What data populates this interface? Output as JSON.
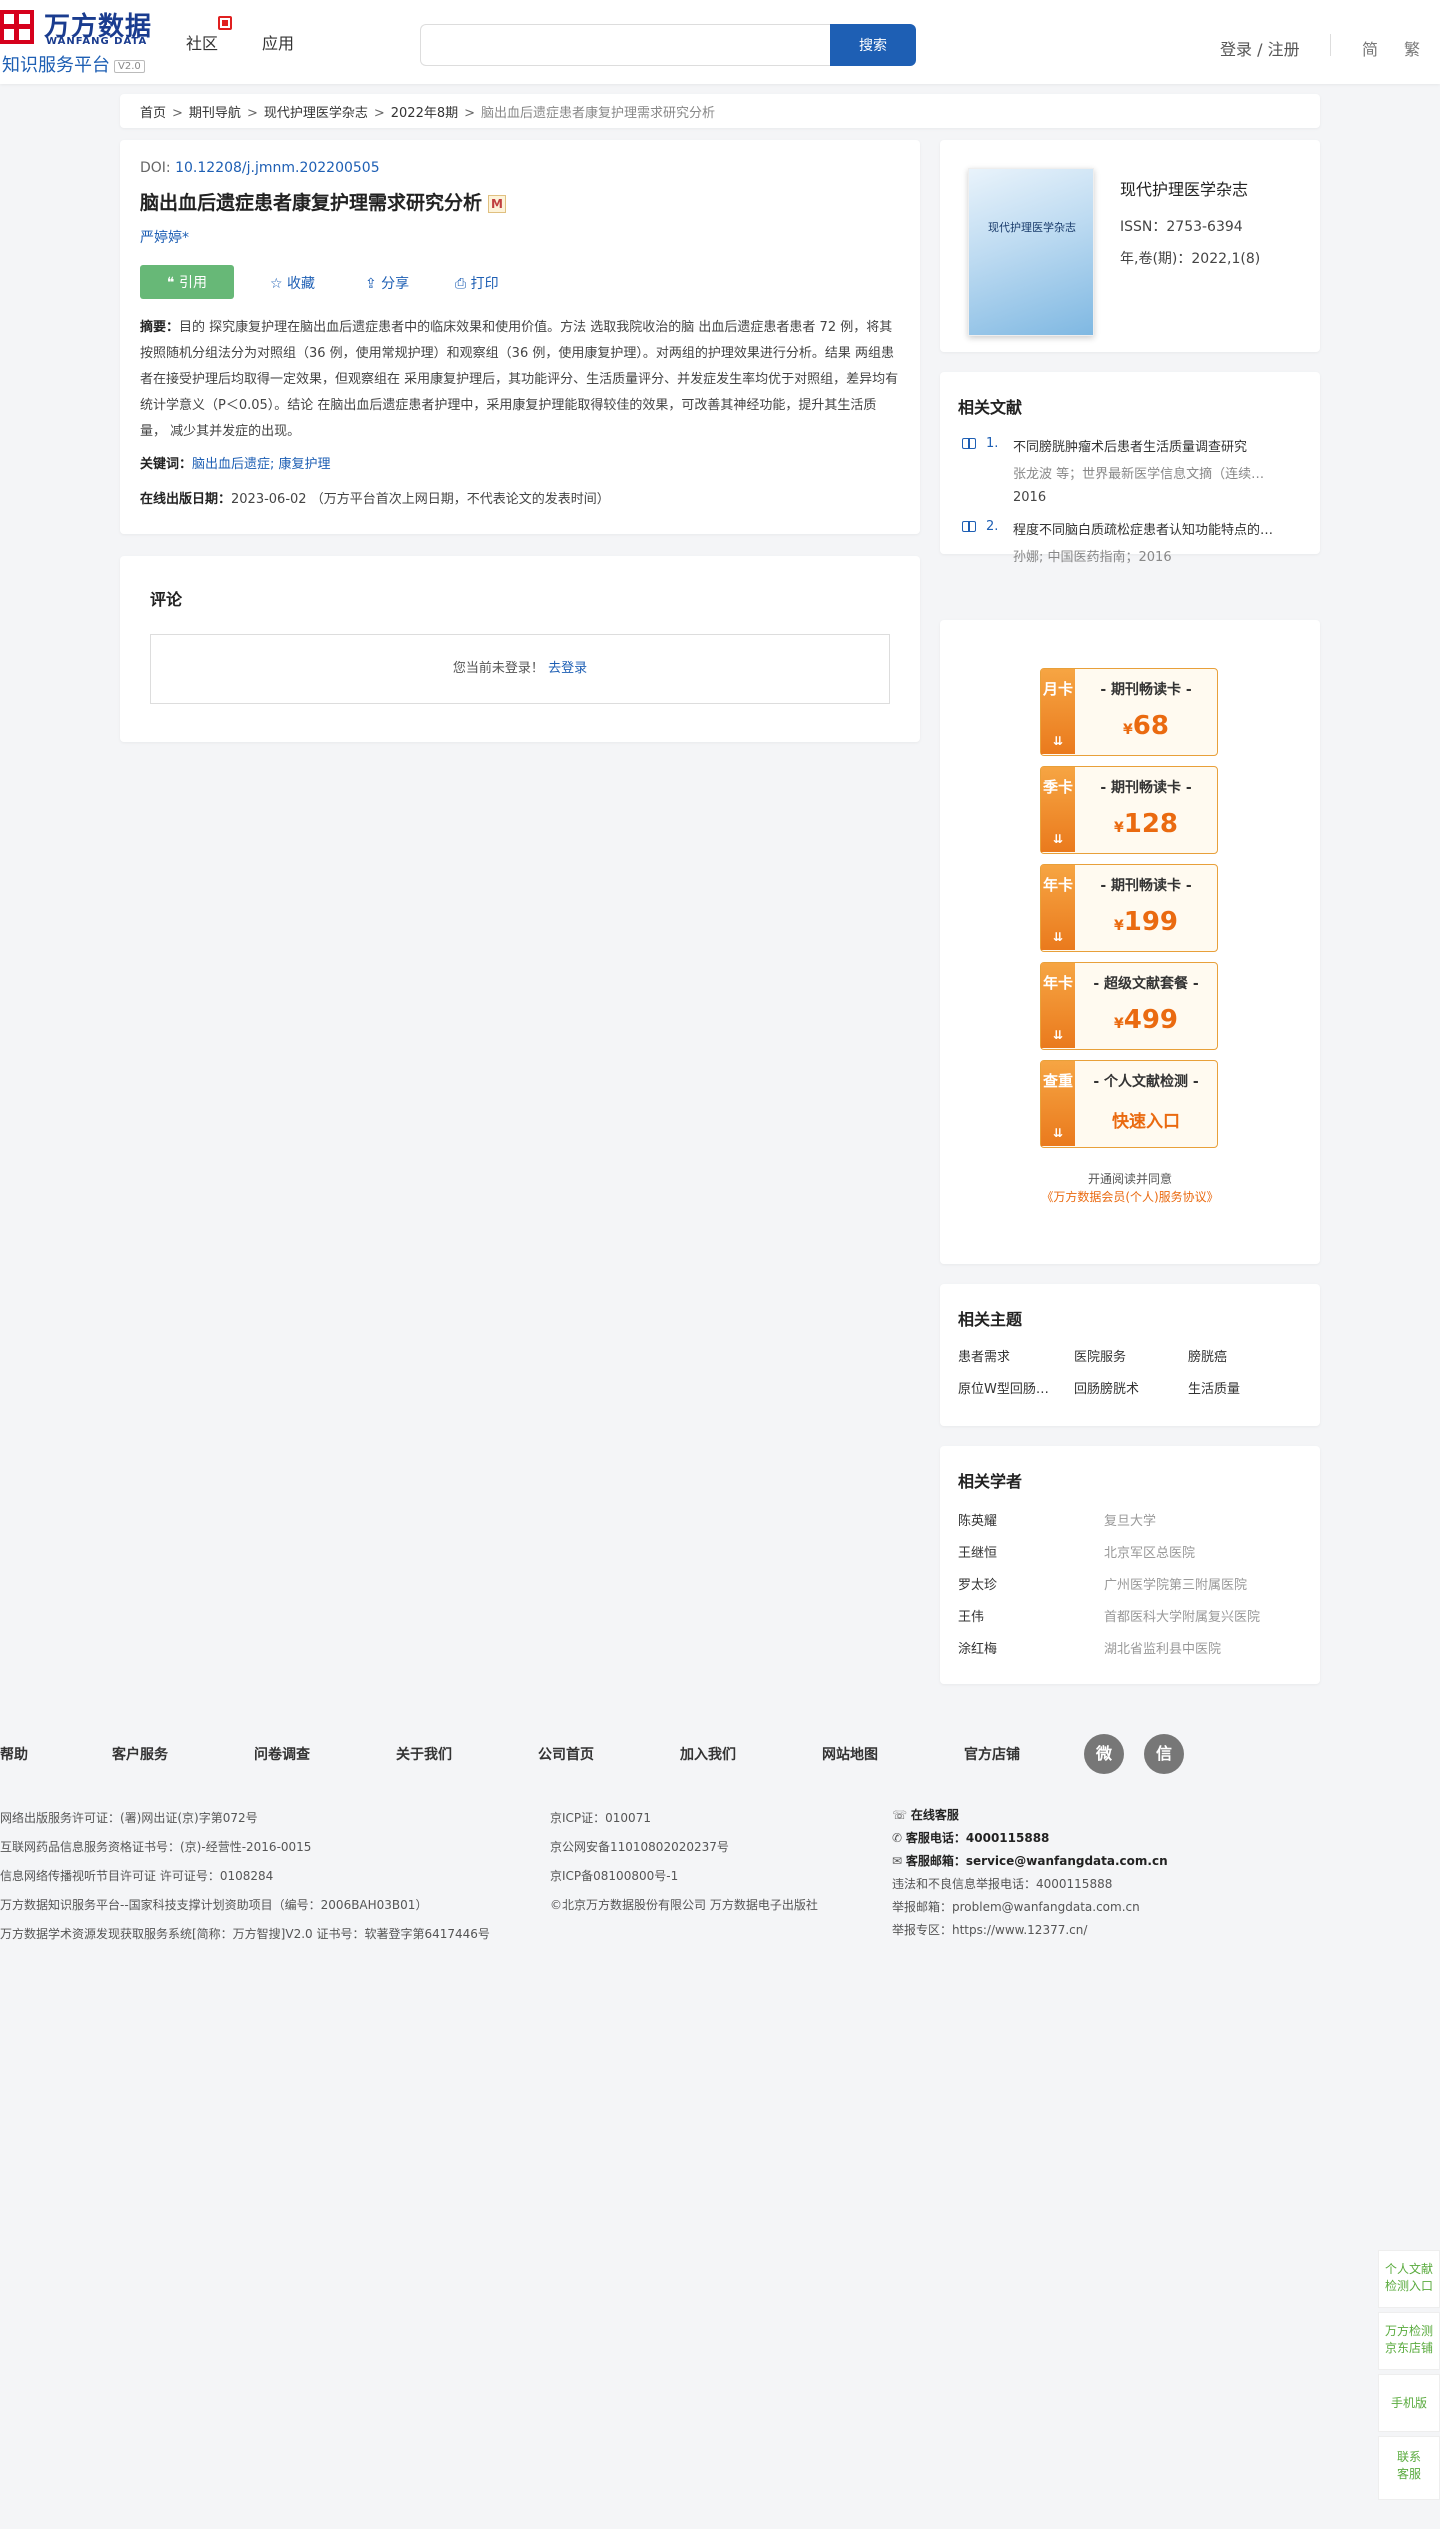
{
  "header": {
    "logo_cn": "万方数据",
    "logo_en": "WANFANG DATA",
    "logo_sub": "知识服务平台",
    "logo_ver": "V2.0",
    "nav": [
      "社区",
      "应用"
    ],
    "search_placeholder": "",
    "search_button": "搜索",
    "login": "登录 / 注册",
    "lang_simple": "简",
    "lang_trad": "繁"
  },
  "breadcrumb": {
    "items": [
      "首页",
      "期刊导航",
      "现代护理医学杂志",
      "2022年8期"
    ],
    "current": "脑出血后遗症患者康复护理需求研究分析",
    "sep": ">"
  },
  "article": {
    "doi_label": "DOI: ",
    "doi": "10.12208/j.jmnm.202200505",
    "title": "脑出血后遗症患者康复护理需求研究分析",
    "title_icon": "M",
    "author": "严婷婷*",
    "cite_label": "❝ 引用",
    "collect_label": "☆ 收藏",
    "share_label": "⇪ 分享",
    "print_label": "⎙ 打印",
    "abstract_label": "摘要：",
    "abstract": "目的 探究康复护理在脑出血后遗症患者中的临床效果和使用价值。方法 选取我院收治的脑 出血后遗症患者患者 72 例，将其按照随机分组法分为对照组（36 例，使用常规护理）和观察组（36 例，使用康复护理）。对两组的护理效果进行分析。结果 两组患者在接受护理后均取得一定效果，但观察组在 采用康复护理后，其功能评分、生活质量评分、并发症发生率均优于对照组，差异均有统计学意义（P＜0.05）。结论 在脑出血后遗症患者护理中，采用康复护理能取得较佳的效果，可改善其神经功能，提升其生活质量， 减少其并发症的出现。",
    "keywords_label": "关键词：",
    "keywords": [
      "脑出血后遗症;",
      "康复护理"
    ],
    "online_label": "在线出版日期：",
    "online_date": "2023-06-02 （万方平台首次上网日期，不代表论文的发表时间）"
  },
  "comments": {
    "title": "评论",
    "not_logged": "您当前未登录！",
    "go_login": "去登录"
  },
  "journal": {
    "cover_title": "现代护理医学杂志",
    "name": "现代护理医学杂志",
    "issn": "ISSN：2753-6394",
    "volume": "年,卷(期)：2022,1(8)"
  },
  "related_docs": {
    "title": "相关文献",
    "items": [
      {
        "num": "1.",
        "title": "不同膀胱肿瘤术后患者生活质量调查研究",
        "meta": "张龙波 等；世界最新医学信息文摘（连续…",
        "year": "2016"
      },
      {
        "num": "2.",
        "title": "程度不同脑白质疏松症患者认知功能特点的…",
        "meta": "孙娜; 中国医药指南；2016",
        "year": ""
      }
    ]
  },
  "vip_cards": [
    {
      "side": "月卡",
      "name": "- 期刊畅读卡 -",
      "currency": "¥",
      "price": "68"
    },
    {
      "side": "季卡",
      "name": "- 期刊畅读卡 -",
      "currency": "¥",
      "price": "128"
    },
    {
      "side": "年卡",
      "name": "- 期刊畅读卡 -",
      "currency": "¥",
      "price": "199"
    },
    {
      "side": "年卡",
      "name": "- 超级文献套餐 -",
      "currency": "¥",
      "price": "499"
    },
    {
      "side": "查重",
      "name": "- 个人文献检测 -",
      "link": "快速入口"
    }
  ],
  "vip_agree": {
    "line1": "开通阅读并同意",
    "line2": "《万方数据会员(个人)服务协议》"
  },
  "topics": {
    "title": "相关主题",
    "items": [
      "患者需求",
      "医院服务",
      "膀胱癌",
      "原位W型回肠…",
      "回肠膀胱术",
      "生活质量"
    ]
  },
  "scholars": {
    "title": "相关学者",
    "items": [
      {
        "name": "陈英耀",
        "org": "复旦大学"
      },
      {
        "name": "王继恒",
        "org": "北京军区总医院"
      },
      {
        "name": "罗太珍",
        "org": "广州医学院第三附属医院"
      },
      {
        "name": "王伟",
        "org": "首都医科大学附属复兴医院"
      },
      {
        "name": "涂红梅",
        "org": "湖北省监利县中医院"
      }
    ]
  },
  "footer": {
    "links": [
      "帮助",
      "客户服务",
      "问卷调查",
      "关于我们",
      "公司首页",
      "加入我们",
      "网站地图",
      "官方店铺"
    ],
    "social": [
      {
        "icon": "weibo-icon",
        "glyph": "微"
      },
      {
        "icon": "wechat-icon",
        "glyph": "信"
      }
    ],
    "col1": [
      "网络出版服务许可证：(署)网出证(京)字第072号",
      "互联网药品信息服务资格证书号：(京)-经营性-2016-0015",
      "信息网络传播视听节目许可证 许可证号：0108284",
      "万方数据知识服务平台--国家科技支撑计划资助项目（编号：2006BAH03B01）",
      "万方数据学术资源发现获取服务系统[简称：万方智搜]V2.0 证书号：软著登字第6417446号"
    ],
    "col2": [
      "京ICP证：010071",
      "京公网安备11010802020237号",
      "京ICP备08100800号-1",
      "©北京万方数据股份有限公司 万方数据电子出版社"
    ],
    "col3": {
      "online_service": "在线客服",
      "phone_label": "客服电话：",
      "phone": "4000115888",
      "email_label": "客服邮箱：",
      "email": "service@wanfangdata.com.cn",
      "report_phone": "违法和不良信息举报电话：4000115888",
      "report_email": "举报邮箱：problem@wanfangdata.com.cn",
      "report_zone": "举报专区：https://www.12377.cn/"
    }
  },
  "float_side": [
    {
      "text": "个人文献检测入口"
    },
    {
      "text": "万方检测京东店铺"
    },
    {
      "text": "手机版"
    },
    {
      "text": "联系客服"
    }
  ]
}
